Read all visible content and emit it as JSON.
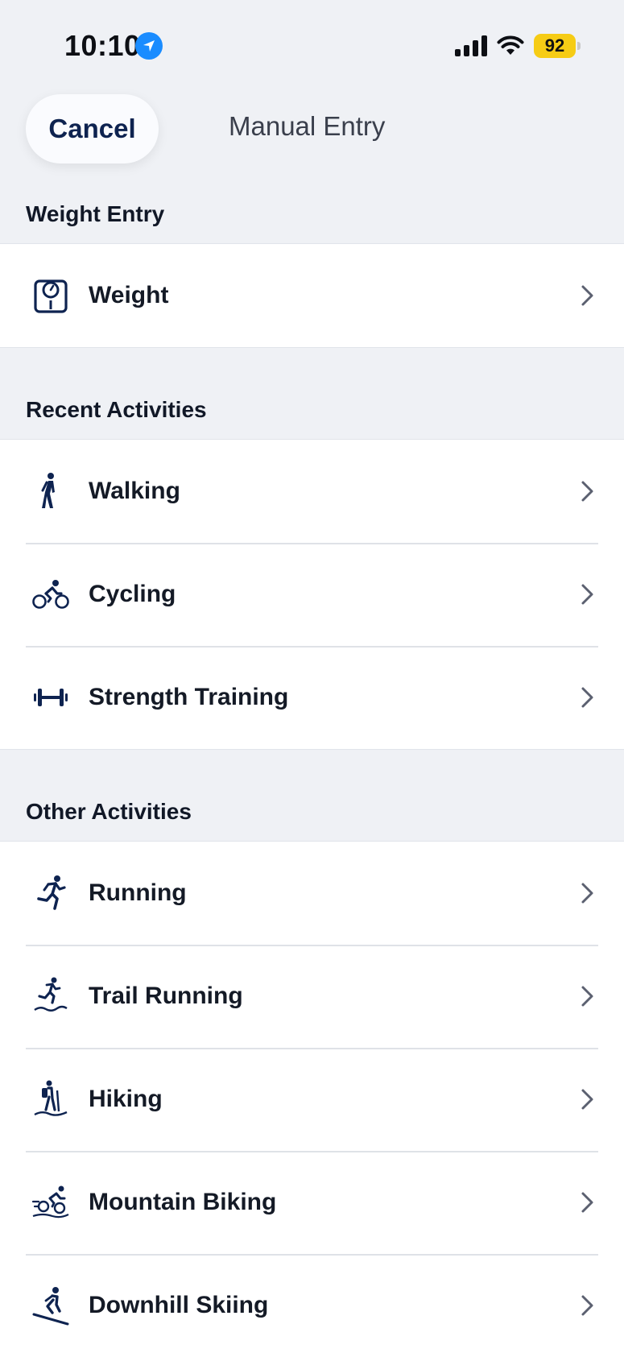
{
  "status_bar": {
    "time": "10:10",
    "battery": "92",
    "battery_color": "#f6cc15",
    "location_badge_color": "#1a8cff"
  },
  "header": {
    "cancel_label": "Cancel",
    "title": "Manual Entry"
  },
  "sections": {
    "weight": {
      "title": "Weight Entry",
      "items": [
        {
          "label": "Weight",
          "icon": "scale-icon"
        }
      ]
    },
    "recent": {
      "title": "Recent Activities",
      "items": [
        {
          "label": "Walking",
          "icon": "walking-icon"
        },
        {
          "label": "Cycling",
          "icon": "cycling-icon"
        },
        {
          "label": "Strength Training",
          "icon": "dumbbell-icon"
        }
      ]
    },
    "other": {
      "title": "Other Activities",
      "items": [
        {
          "label": "Running",
          "icon": "running-icon"
        },
        {
          "label": "Trail Running",
          "icon": "trail-running-icon"
        },
        {
          "label": "Hiking",
          "icon": "hiking-icon"
        },
        {
          "label": "Mountain Biking",
          "icon": "mountain-biking-icon"
        },
        {
          "label": "Downhill Skiing",
          "icon": "skiing-icon"
        }
      ]
    }
  },
  "colors": {
    "icon": "#0e2350",
    "background": "#eff1f5",
    "row_background": "#ffffff"
  }
}
